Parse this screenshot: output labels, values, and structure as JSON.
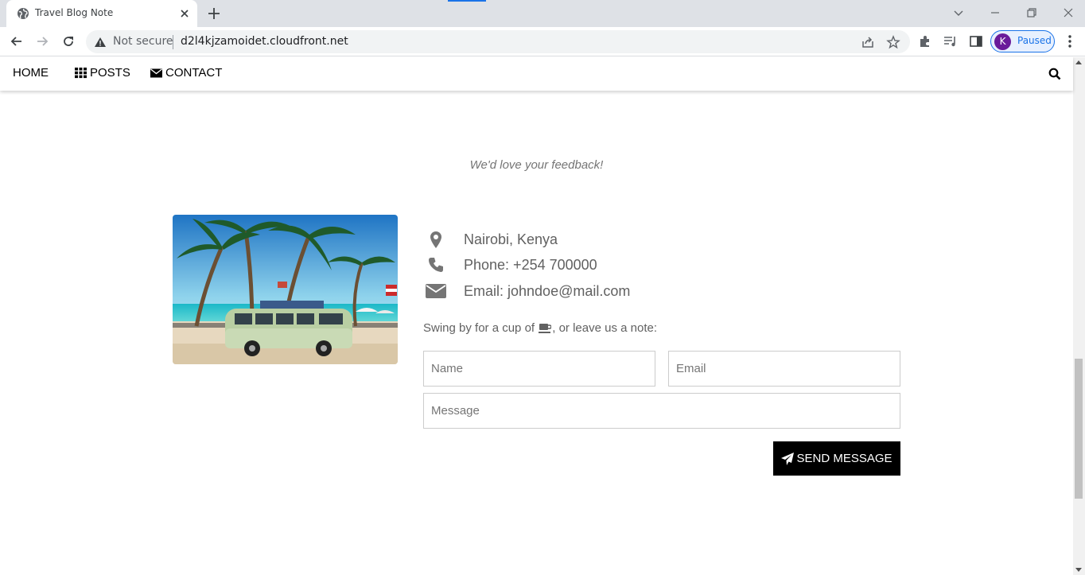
{
  "browser": {
    "tab_title": "Travel Blog Note",
    "security_label": "Not secure",
    "url": "d2l4kjzamoidet.cloudfront.net",
    "profile_initial": "K",
    "profile_status": "Paused",
    "accent_color": "#1a73e8"
  },
  "nav": {
    "home": "HOME",
    "posts": "POSTS",
    "contact": "CONTACT"
  },
  "contact": {
    "tagline": "We'd love your feedback!",
    "location": "Nairobi, Kenya",
    "phone": "Phone: +254 700000",
    "email": "Email: johndoe@mail.com",
    "note_before": "Swing by for a cup of",
    "note_after": ", or leave us a note:"
  },
  "form": {
    "name_placeholder": "Name",
    "email_placeholder": "Email",
    "message_placeholder": "Message",
    "send_label": "SEND MESSAGE"
  }
}
